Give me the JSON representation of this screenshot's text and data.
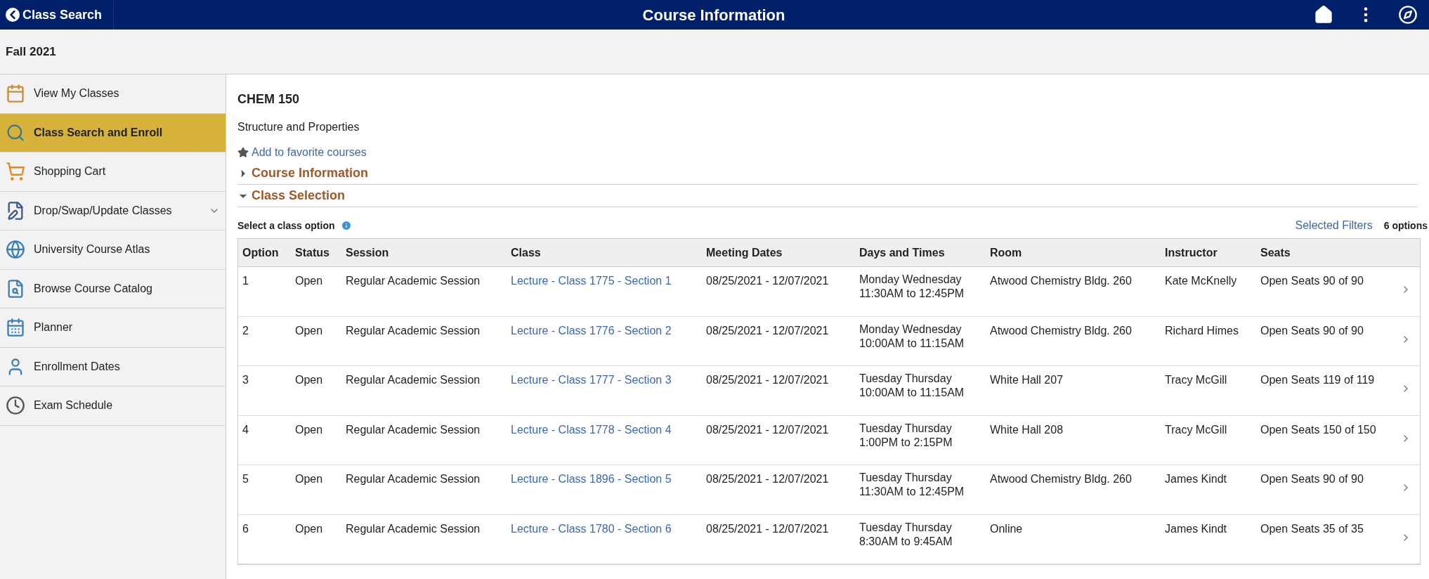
{
  "header": {
    "back_label": "Class Search",
    "title": "Course Information"
  },
  "term": "Fall 2021",
  "sidebar": {
    "items": [
      {
        "kind": "calendar",
        "label": "View My Classes",
        "selected": false,
        "expandable": false
      },
      {
        "kind": "search",
        "label": "Class Search and Enroll",
        "selected": true,
        "expandable": false
      },
      {
        "kind": "cart",
        "label": "Shopping Cart",
        "selected": false,
        "expandable": false
      },
      {
        "kind": "edit",
        "label": "Drop/Swap/Update Classes",
        "selected": false,
        "expandable": true
      },
      {
        "kind": "globe",
        "label": "University Course Atlas",
        "selected": false,
        "expandable": false
      },
      {
        "kind": "catalog",
        "label": "Browse Course Catalog",
        "selected": false,
        "expandable": false
      },
      {
        "kind": "planner",
        "label": "Planner",
        "selected": false,
        "expandable": false
      },
      {
        "kind": "person",
        "label": "Enrollment Dates",
        "selected": false,
        "expandable": false
      },
      {
        "kind": "clock",
        "label": "Exam Schedule",
        "selected": false,
        "expandable": false
      }
    ]
  },
  "course": {
    "code": "CHEM 150",
    "title": "Structure and Properties",
    "favorite_link": "Add to favorite courses"
  },
  "sections": [
    {
      "label": "Course Information",
      "expanded": false
    },
    {
      "label": "Class Selection",
      "expanded": true
    }
  ],
  "table": {
    "caption": "Select a class option",
    "filters_link": "Selected Filters",
    "count": "6 options",
    "columns": [
      "Option",
      "Status",
      "Session",
      "Class",
      "Meeting Dates",
      "Days and Times",
      "Room",
      "Instructor",
      "Seats"
    ],
    "rows": [
      {
        "option": "1",
        "status": "Open",
        "session": "Regular Academic Session",
        "class": "Lecture - Class 1775 - Section 1",
        "dates": "08/25/2021 - 12/07/2021",
        "days": "Monday Wednesday",
        "times": "11:30AM to 12:45PM",
        "room": "Atwood Chemistry Bldg. 260",
        "instructor": "Kate McKnelly",
        "seats": "Open Seats 90 of 90"
      },
      {
        "option": "2",
        "status": "Open",
        "session": "Regular Academic Session",
        "class": "Lecture - Class 1776 - Section 2",
        "dates": "08/25/2021 - 12/07/2021",
        "days": "Monday Wednesday",
        "times": "10:00AM to 11:15AM",
        "room": "Atwood Chemistry Bldg. 260",
        "instructor": "Richard Himes",
        "seats": "Open Seats 90 of 90"
      },
      {
        "option": "3",
        "status": "Open",
        "session": "Regular Academic Session",
        "class": "Lecture - Class 1777 - Section 3",
        "dates": "08/25/2021 - 12/07/2021",
        "days": "Tuesday Thursday",
        "times": "10:00AM to 11:15AM",
        "room": "White Hall 207",
        "instructor": "Tracy McGill",
        "seats": "Open Seats 119 of 119"
      },
      {
        "option": "4",
        "status": "Open",
        "session": "Regular Academic Session",
        "class": "Lecture - Class 1778 - Section 4",
        "dates": "08/25/2021 - 12/07/2021",
        "days": "Tuesday Thursday",
        "times": "1:00PM to 2:15PM",
        "room": "White Hall 208",
        "instructor": "Tracy McGill",
        "seats": "Open Seats 150 of 150"
      },
      {
        "option": "5",
        "status": "Open",
        "session": "Regular Academic Session",
        "class": "Lecture - Class 1896 - Section 5",
        "dates": "08/25/2021 - 12/07/2021",
        "days": "Tuesday Thursday",
        "times": "11:30AM to 12:45PM",
        "room": "Atwood Chemistry Bldg. 260",
        "instructor": "James Kindt",
        "seats": "Open Seats 90 of 90"
      },
      {
        "option": "6",
        "status": "Open",
        "session": "Regular Academic Session",
        "class": "Lecture - Class 1780 - Section 6",
        "dates": "08/25/2021 - 12/07/2021",
        "days": "Tuesday Thursday",
        "times": "8:30AM to 9:45AM",
        "room": "Online",
        "instructor": "James Kindt",
        "seats": "Open Seats 35 of 35"
      }
    ]
  }
}
